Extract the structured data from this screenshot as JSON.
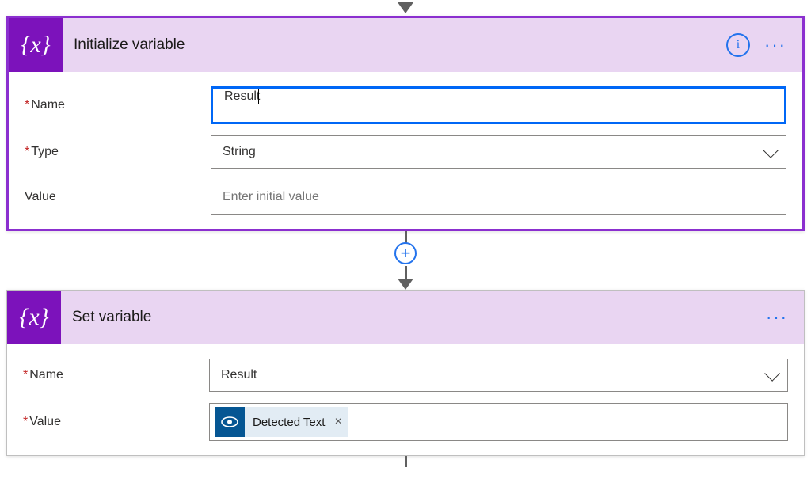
{
  "connector": {
    "plus_label": "+"
  },
  "card1": {
    "icon_text": "{x}",
    "title": "Initialize variable",
    "info_glyph": "i",
    "more_glyph": "···",
    "fields": {
      "name": {
        "label": "Name",
        "required": true,
        "value": "Result"
      },
      "type": {
        "label": "Type",
        "required": true,
        "value": "String"
      },
      "value": {
        "label": "Value",
        "required": false,
        "placeholder": "Enter initial value"
      }
    }
  },
  "card2": {
    "icon_text": "{x}",
    "title": "Set variable",
    "more_glyph": "···",
    "fields": {
      "name": {
        "label": "Name",
        "required": true,
        "value": "Result"
      },
      "value": {
        "label": "Value",
        "required": true,
        "token": {
          "label": "Detected Text",
          "remove": "×"
        }
      }
    }
  }
}
